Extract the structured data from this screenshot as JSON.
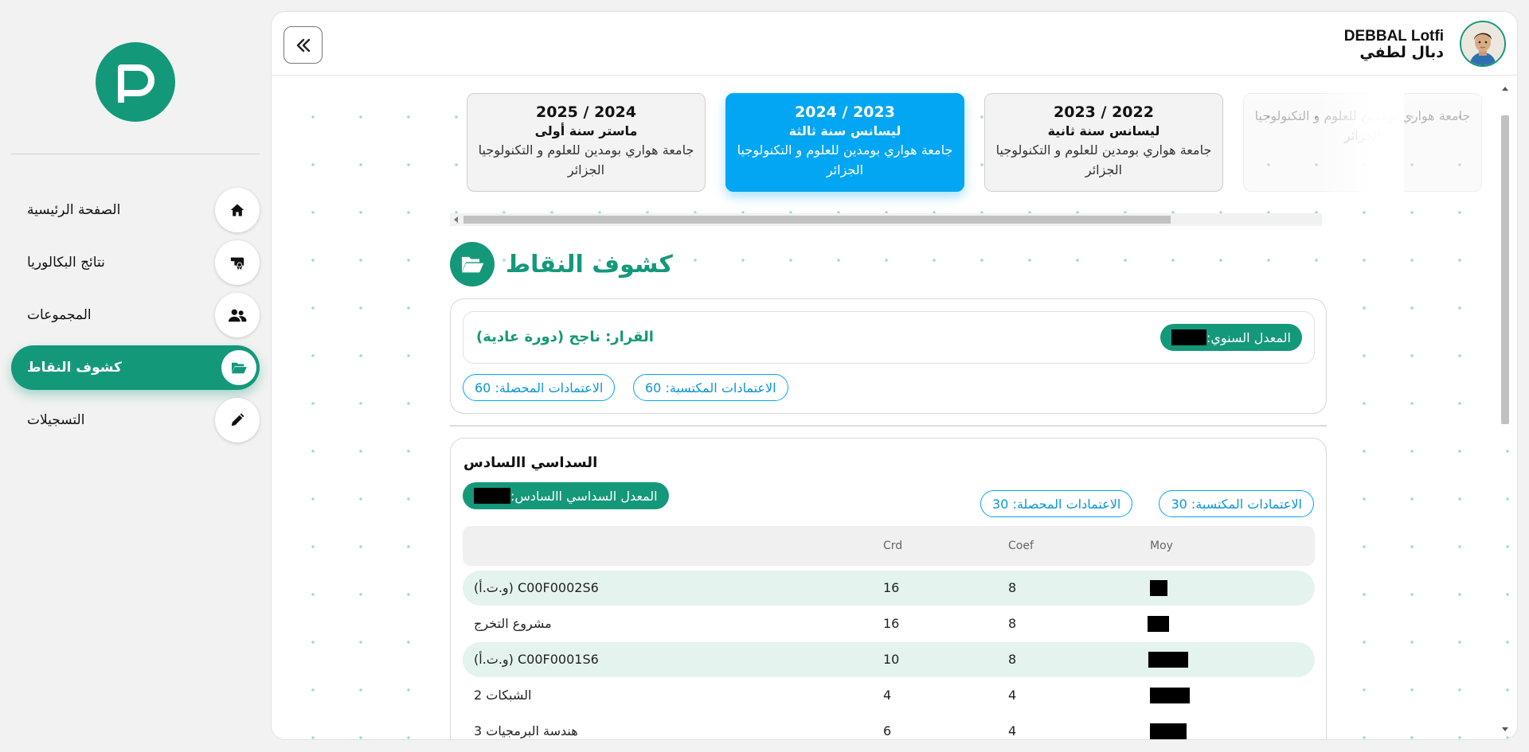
{
  "sidebar": {
    "items": [
      {
        "label": "الصفحة الرئيسية",
        "icon": "home-icon",
        "active": false
      },
      {
        "label": "نتائج البكالوريا",
        "icon": "certificate-icon",
        "active": false
      },
      {
        "label": "المجموعات",
        "icon": "users-icon",
        "active": false
      },
      {
        "label": "كشوف النقاط",
        "icon": "folder-open-icon",
        "active": true
      },
      {
        "label": "التسجيلات",
        "icon": "pencil-icon",
        "active": false
      }
    ]
  },
  "header": {
    "collapse_icon": "double-chevron-left-icon",
    "user_name_latin": "DEBBAL Lotfi",
    "user_name_arabic": "دبال لطفي"
  },
  "years": [
    {
      "year": "2024 / 2025",
      "level": "ماستر سنة أولى",
      "university": "جامعة هواري بومدين للعلوم و التكنولوجيا الجزائر",
      "active": false
    },
    {
      "year": "2023 / 2024",
      "level": "ليسانس سنة ثالثة",
      "university": "جامعة هواري بومدين للعلوم و التكنولوجيا الجزائر",
      "active": true
    },
    {
      "year": "2022 / 2023",
      "level": "ليسانس سنة ثانية",
      "university": "جامعة هواري بومدين للعلوم و التكنولوجيا الجزائر",
      "active": false
    },
    {
      "year": "",
      "level": "",
      "university": "جامعة هواري بومدين للعلوم و التكنولوجيا الجزائر",
      "active": false
    }
  ],
  "section": {
    "title": "كشوف النقاط",
    "icon": "folder-open-icon"
  },
  "decision": {
    "text": "القرار: ناجح (دورة عادية)",
    "annual_average_label": "المعدل السنوي:",
    "credits_acquired": "الاعتمادات المكتسبة: 60",
    "credits_obtained": "الاعتمادات المحصلة: 60"
  },
  "semester": {
    "title": "السداسي االسادس",
    "average_label": "المعدل السداسي االسادس:",
    "credits_acquired": "الاعتمادات المكتسبة: 30",
    "credits_obtained": "الاعتمادات المحصلة: 30",
    "columns": {
      "crd": "Crd",
      "coef": "Coef",
      "moy": "Moy"
    },
    "rows": [
      {
        "name": "C00F0002S6 (و.ت.أ)",
        "crd": "16",
        "coef": "8"
      },
      {
        "name": "مشروع التخرج",
        "crd": "16",
        "coef": "8"
      },
      {
        "name": "C00F0001S6 (و.ت.أ)",
        "crd": "10",
        "coef": "8"
      },
      {
        "name": "الشبكات 2",
        "crd": "4",
        "coef": "4"
      },
      {
        "name": "هندسة البرمجيات 3",
        "crd": "6",
        "coef": "4"
      }
    ]
  },
  "colors": {
    "accent_green": "#14987a",
    "accent_blue": "#03a6f3",
    "row_alt": "#e4f3ee"
  }
}
